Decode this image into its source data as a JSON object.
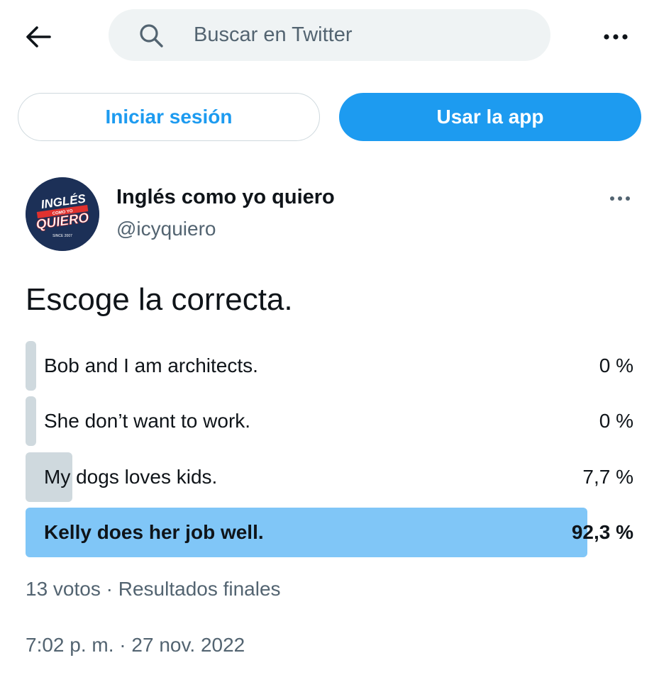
{
  "header": {
    "search_placeholder": "Buscar en Twitter"
  },
  "actions": {
    "login_label": "Iniciar sesión",
    "app_label": "Usar la app"
  },
  "author": {
    "name": "Inglés como yo quiero",
    "handle": "@icyquiero",
    "avatar_text_top": "INGLÉS",
    "avatar_text_mid": "COMO YO",
    "avatar_text_bottom": "QUIERO",
    "avatar_text_since": "SINCE 2007"
  },
  "tweet": {
    "text": "Escoge la correcta."
  },
  "poll": {
    "options": [
      {
        "label": "Bob and I am architects.",
        "percent_text": "0 %",
        "percent": 0
      },
      {
        "label": "She don’t want to work.",
        "percent_text": "0 %",
        "percent": 0
      },
      {
        "label": "My dogs loves kids.",
        "percent_text": "7,7 %",
        "percent": 7.7
      },
      {
        "label": "Kelly does her job well.",
        "percent_text": "92,3 %",
        "percent": 92.3,
        "winner": true
      }
    ],
    "votes": "13 votos",
    "separator": " · ",
    "status": "Resultados finales"
  },
  "timestamp": {
    "time": "7:02 p. m.",
    "separator": " · ",
    "date": "27 nov. 2022"
  },
  "colors": {
    "accent": "#1d9bf0",
    "winner_bar": "#80c6f7",
    "loser_bar": "#cfd9de",
    "secondary_text": "#536471"
  },
  "icons": [
    "arrow-left-icon",
    "search-icon",
    "more-horizontal-icon"
  ]
}
